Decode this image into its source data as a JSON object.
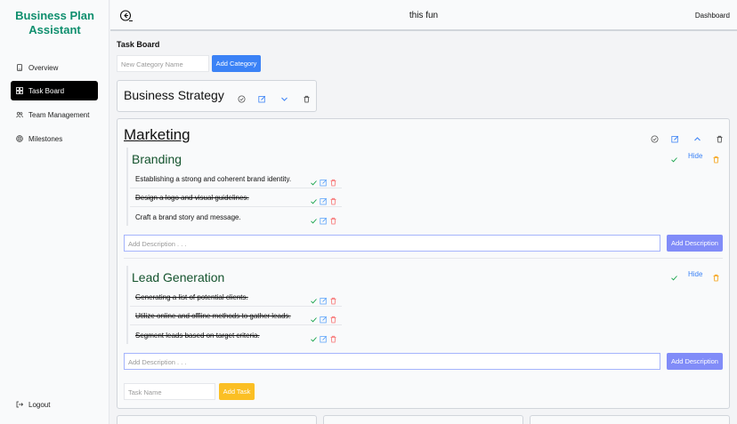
{
  "sidebar": {
    "brand": "Business Plan Assistant",
    "items": [
      {
        "label": "Overview",
        "icon": "book-icon"
      },
      {
        "label": "Task Board",
        "icon": "grid-icon"
      },
      {
        "label": "Team Management",
        "icon": "users-icon"
      },
      {
        "label": "Milestones",
        "icon": "target-icon"
      }
    ],
    "logout": "Logout"
  },
  "topbar": {
    "title": "this fun",
    "dashboard": "Dashboard"
  },
  "board": {
    "title": "Task Board",
    "category_placeholder": "New Category Name",
    "add_category": "Add Category",
    "categories": [
      {
        "name": "Business Strategy"
      },
      {
        "name": "Marketing",
        "subcategories": [
          {
            "name": "Branding",
            "hide": "Hide",
            "tasks": [
              {
                "text": "Establishing a strong and coherent brand identity.",
                "done": false
              },
              {
                "text": "Design a logo and visual guidelines.",
                "done": true
              },
              {
                "text": "Craft a brand story and message.",
                "done": false
              }
            ],
            "desc_placeholder": "Add Description . . .",
            "add_desc": "Add Description"
          },
          {
            "name": "Lead Generation",
            "hide": "Hide",
            "tasks": [
              {
                "text": "Generating a list of potential clients.",
                "done": true
              },
              {
                "text": "Utilize online and offline methods to gather leads.",
                "done": true
              },
              {
                "text": "Segment leads based on target criteria.",
                "done": true
              }
            ],
            "desc_placeholder": "Add Description . . .",
            "add_desc": "Add Description"
          }
        ],
        "task_placeholder": "Task Name",
        "add_task": "Add Task"
      }
    ]
  },
  "colors": {
    "brand": "#0f8f6e",
    "blue": "#3b82f6",
    "indigo": "#818cf8",
    "yellow": "#fbbf24",
    "red": "#f87171",
    "green": "#16a34a"
  }
}
